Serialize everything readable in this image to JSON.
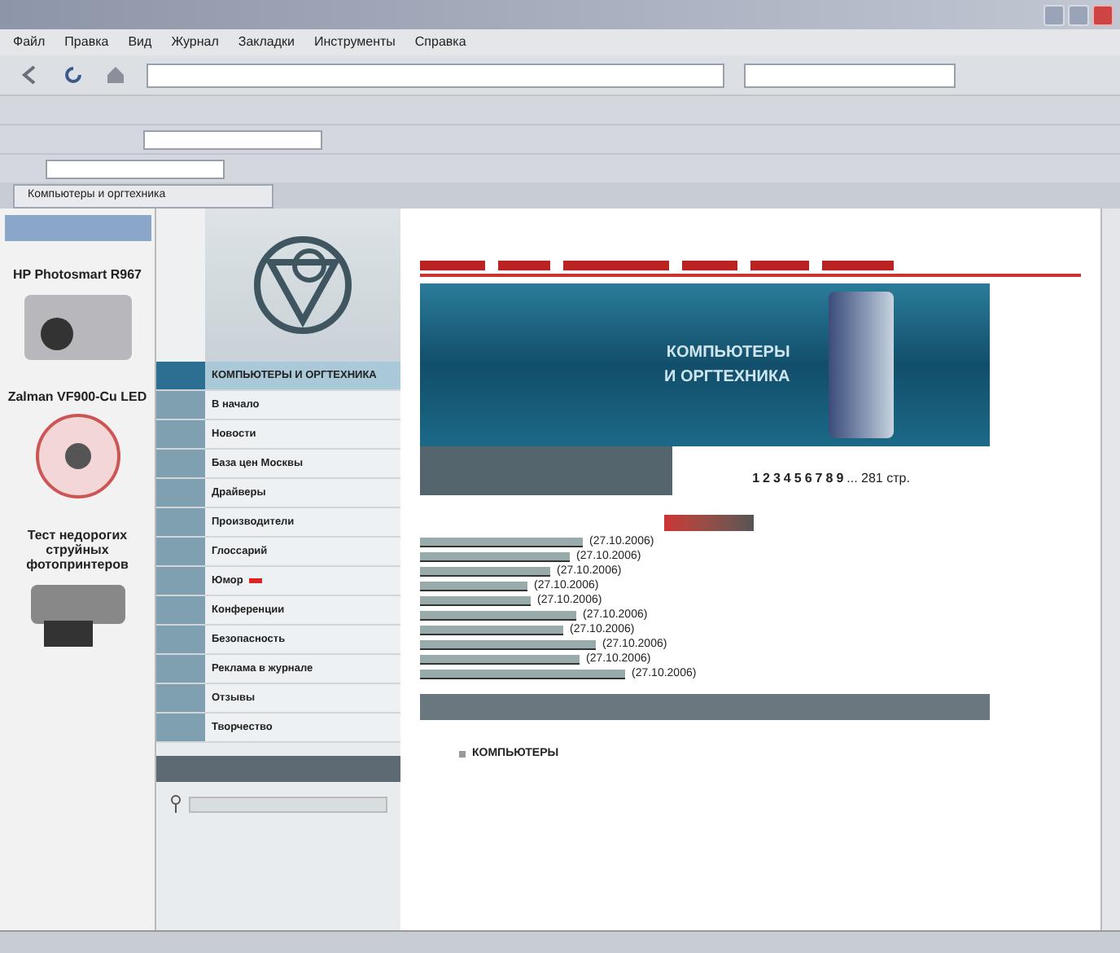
{
  "menu": [
    "Файл",
    "Правка",
    "Вид",
    "Журнал",
    "Закладки",
    "Инструменты",
    "Справка"
  ],
  "tab": {
    "label": "Компьютеры и оргтехника"
  },
  "products": [
    {
      "name": "HP Photosmart R967",
      "kind": "camera"
    },
    {
      "name": "Zalman VF900-Cu LED",
      "kind": "fan"
    },
    {
      "name": "Тест недорогих струйных фотопринтеров",
      "kind": "printer"
    }
  ],
  "nav": [
    {
      "label": "КОМПЬЮТЕРЫ И ОРГТЕХНИКА",
      "selected": true,
      "new": false
    },
    {
      "label": "В начало",
      "selected": false,
      "new": false
    },
    {
      "label": "Новости",
      "selected": false,
      "new": false
    },
    {
      "label": "База цен Москвы",
      "selected": false,
      "new": false
    },
    {
      "label": "Драйверы",
      "selected": false,
      "new": false
    },
    {
      "label": "Производители",
      "selected": false,
      "new": false
    },
    {
      "label": "Глоссарий",
      "selected": false,
      "new": false
    },
    {
      "label": "Юмор",
      "selected": false,
      "new": true
    },
    {
      "label": "Конференции",
      "selected": false,
      "new": false
    },
    {
      "label": "Безопасность",
      "selected": false,
      "new": false
    },
    {
      "label": "Реклама в журнале",
      "selected": false,
      "new": false
    },
    {
      "label": "Отзывы",
      "selected": false,
      "new": false
    },
    {
      "label": "Творчество",
      "selected": false,
      "new": false
    }
  ],
  "banner": {
    "line_1": "КОМПЬЮТЕРЫ",
    "line_2": "И ОРГТЕХНИКА"
  },
  "pager": {
    "pages": [
      "1",
      "2",
      "3",
      "4",
      "5",
      "6",
      "7",
      "8",
      "9"
    ],
    "more": "... 281 стр."
  },
  "news": [
    {
      "date": "(27.10.2006)"
    },
    {
      "date": "(27.10.2006)"
    },
    {
      "date": "(27.10.2006)"
    },
    {
      "date": "(27.10.2006)"
    },
    {
      "date": "(27.10.2006)"
    },
    {
      "date": "(27.10.2006)"
    },
    {
      "date": "(27.10.2006)"
    },
    {
      "date": "(27.10.2006)"
    },
    {
      "date": "(27.10.2006)"
    },
    {
      "date": "(27.10.2006)"
    }
  ],
  "footer_link": "КОМПЬЮТЕРЫ"
}
